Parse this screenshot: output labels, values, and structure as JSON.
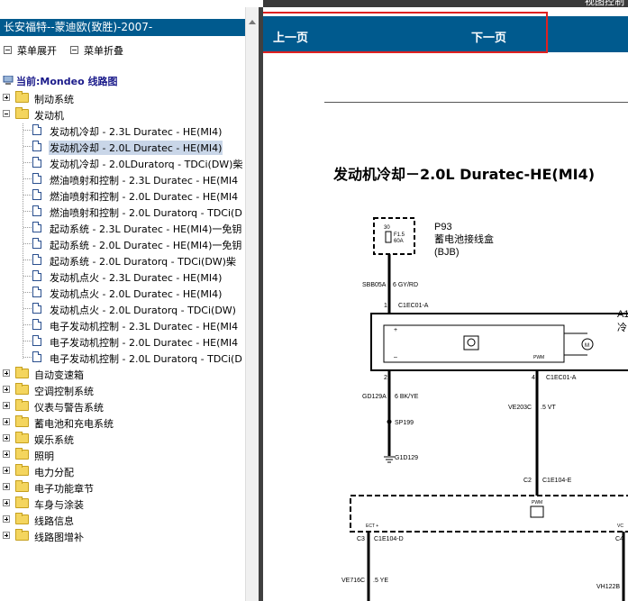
{
  "window": {
    "corner_text": "视图控制"
  },
  "left_panel": {
    "title": "长安福特--蒙迪欧(致胜)-2007-",
    "expand_all": "菜单展开",
    "collapse_all": "菜单折叠",
    "current_label": "当前:Mondeo 线路图",
    "tree": {
      "brakes": "制动系统",
      "engine": "发动机",
      "engine_children": [
        "发动机冷却 - 2.3L Duratec - HE(MI4)",
        "发动机冷却 - 2.0L Duratec - HE(MI4)",
        "发动机冷却 - 2.0LDuratorq - TDCi(DW)柴",
        "燃油喷射和控制 - 2.3L Duratec - HE(MI4",
        "燃油喷射和控制 - 2.0L Duratec - HE(MI4",
        "燃油喷射和控制 - 2.0L Duratorq - TDCi(D",
        "起动系统 - 2.3L Duratec - HE(MI4)一免钥",
        "起动系统 - 2.0L Duratec - HE(MI4)一免钥",
        "起动系统 - 2.0L Duratorq - TDCi(DW)柴",
        "发动机点火 - 2.3L Duratec - HE(MI4)",
        "发动机点火 - 2.0L Duratec - HE(MI4)",
        "发动机点火 - 2.0L Duratorq - TDCi(DW)",
        "电子发动机控制 - 2.3L Duratec - HE(MI4",
        "电子发动机控制 - 2.0L Duratec - HE(MI4",
        "电子发动机控制 - 2.0L Duratorq - TDCi(D"
      ],
      "selected_index": 1,
      "other_folders": [
        "自动变速箱",
        "空调控制系统",
        "仪表与警告系统",
        "蓄电池和充电系统",
        "娱乐系统",
        "照明",
        "电力分配",
        "电子功能章节",
        "车身与涂装",
        "线路信息",
        "线路图增补"
      ]
    }
  },
  "right_panel": {
    "prev_page": "上一页",
    "next_page": "下一页",
    "doc_title": "发动机冷却－2.0L Duratec-HE(MI4)",
    "diagram": {
      "fuse_num": "30",
      "fuse_label_1": "F1.5",
      "fuse_label_2": "60A",
      "p93": "P93",
      "p93_desc": "蓄电池接线盒",
      "bjb": "(BJB)",
      "wire1_id": "SBB05A",
      "wire1_spec": "6 GY/RD",
      "pin1": "1",
      "conn1": "C1EC01-A",
      "module_id": "A1",
      "module_desc": "冷",
      "pwm1": "PWM",
      "pin2": "2",
      "pin4": "4",
      "conn2": "C1EC01-A",
      "gd_id": "GD129A",
      "gd_spec": "6 BK/YE",
      "sp_id": "SP199",
      "g_id": "G1D129",
      "ve1_id": "VE203C",
      "ve1_spec": ".5 VT",
      "pin_c2": "C2",
      "conn_c2": "C1E104-E",
      "pwm2": "PWM",
      "ect": "ECT +",
      "vc": "VC",
      "pin_c3": "C3",
      "conn_c3": "C1E104-D",
      "pin_c4": "C4",
      "ve2_id": "VE716C",
      "ve2_spec": ".5 YE",
      "vh_id": "VH122B"
    }
  }
}
